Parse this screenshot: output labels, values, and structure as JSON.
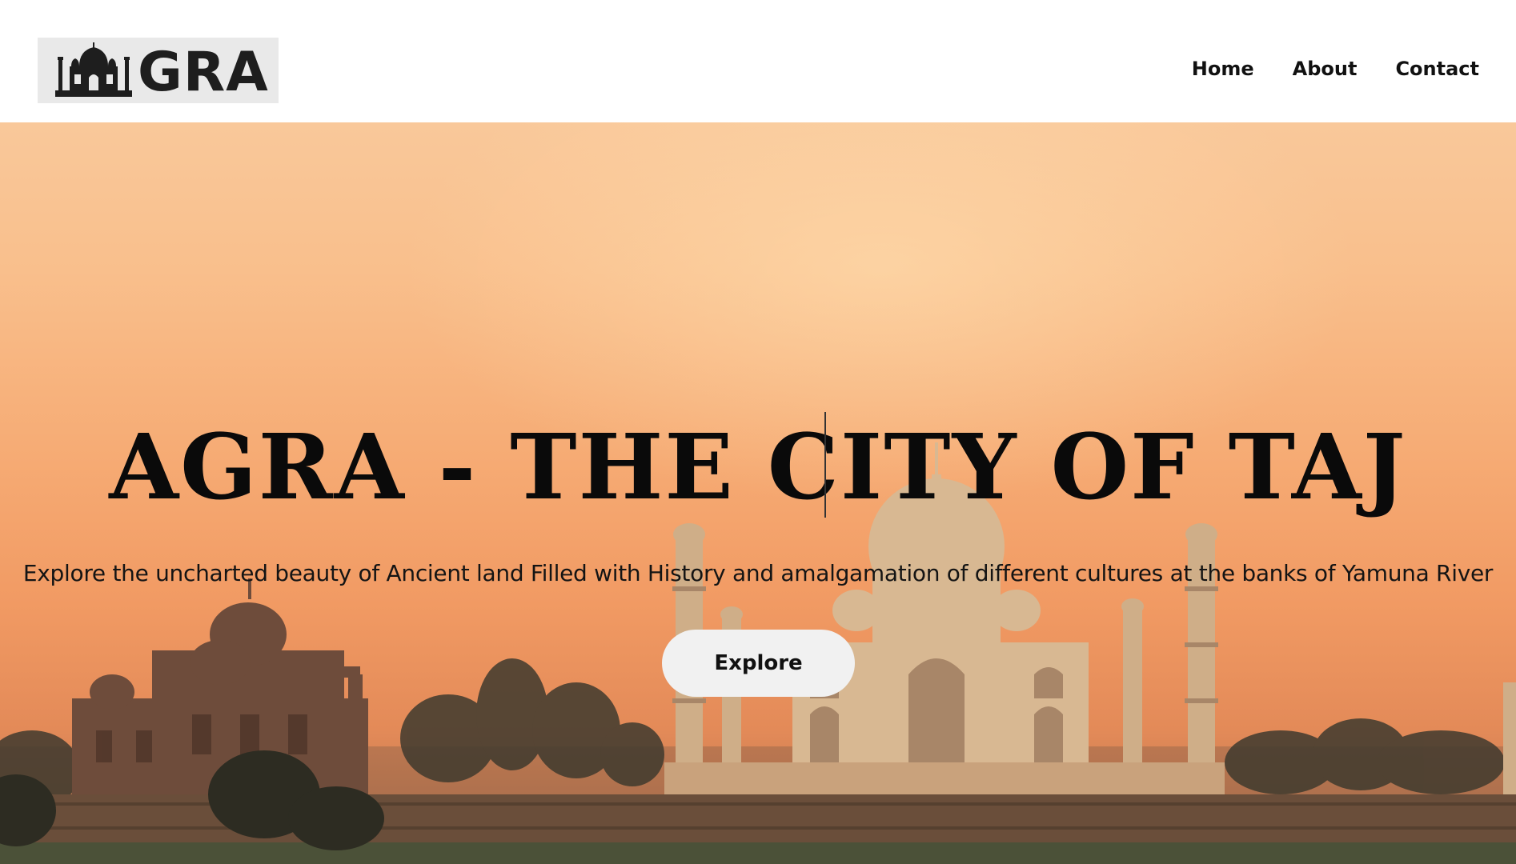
{
  "brand": {
    "logo_text": "GRA",
    "logo_icon": "taj-mahal-icon"
  },
  "nav": {
    "items": [
      {
        "label": "Home"
      },
      {
        "label": "About"
      },
      {
        "label": "Contact"
      }
    ]
  },
  "hero": {
    "title": "AGRA - THE CITY OF TAJ",
    "subtitle": "Explore the uncharted beauty of Ancient land Filled with History and amalgamation of different cultures at the banks of Yamuna River",
    "cta_label": "Explore",
    "background": "taj-mahal-sunset-photo"
  },
  "colors": {
    "navbar_bg": "#ffffff",
    "logo_bg": "#e9e9e9",
    "text": "#111111",
    "button_bg": "#f1f1f1",
    "sky_top": "#f9c89a",
    "sky_bottom": "#e38a58"
  }
}
